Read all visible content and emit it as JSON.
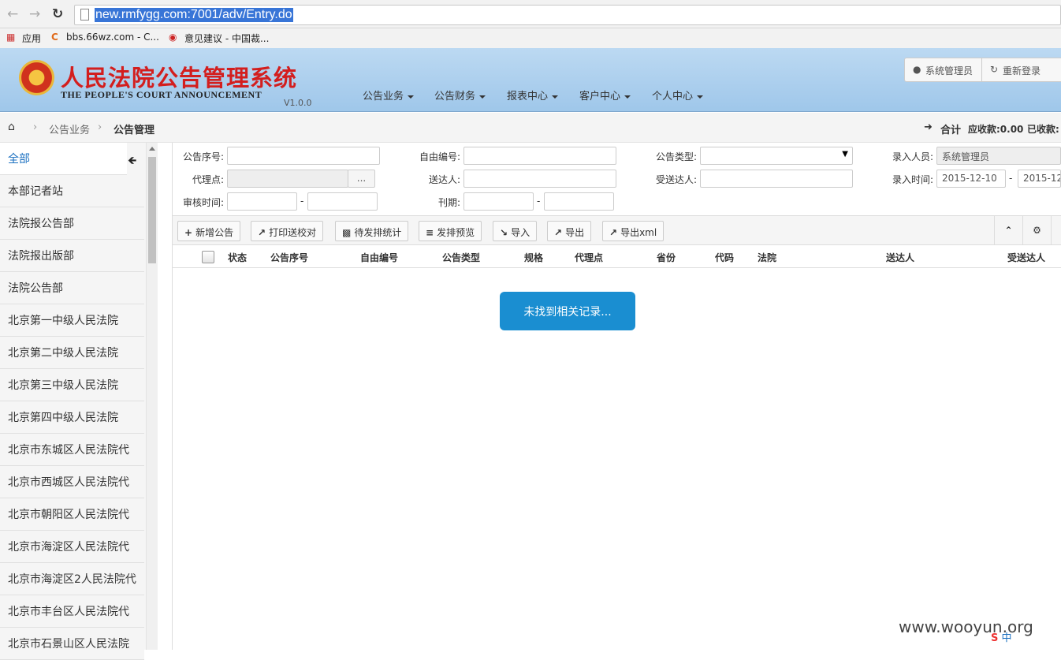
{
  "browser": {
    "back_icon": "arrow-left-icon",
    "forward_icon": "arrow-right-icon",
    "reload_icon": "reload-icon",
    "url": "new.rmfygg.com:7001/adv/Entry.do",
    "bookmarks": [
      "应用",
      "bbs.66wz.com - C...",
      "意见建议 - 中国裁..."
    ]
  },
  "header": {
    "title_cn": "人民法院公告管理系统",
    "title_en": "THE PEOPLE'S COURT ANNOUNCEMENT",
    "version": "V1.0.0",
    "menu": [
      "公告业务",
      "公告财务",
      "报表中心",
      "客户中心",
      "个人中心"
    ],
    "user_label": "系统管理员",
    "relogin_label": "重新登录"
  },
  "breadcrumb": {
    "items": [
      "公告业务",
      "公告管理"
    ],
    "summary_total": "合计",
    "summary_receivable": "应收款:0.00",
    "summary_received": "已收款:"
  },
  "sidebar": {
    "items": [
      "全部",
      "本部记者站",
      "法院报公告部",
      "法院报出版部",
      "法院公告部",
      "北京第一中级人民法院",
      "北京第二中级人民法院",
      "北京第三中级人民法院",
      "北京第四中级人民法院",
      "北京市东城区人民法院代",
      "北京市西城区人民法院代",
      "北京市朝阳区人民法院代",
      "北京市海淀区人民法院代",
      "北京市海淀区2人民法院代",
      "北京市丰台区人民法院代",
      "北京市石景山区人民法院"
    ]
  },
  "filters": {
    "serial_label": "公告序号:",
    "free_no_label": "自由编号:",
    "type_label": "公告类型:",
    "entry_user_label": "录入人员:",
    "entry_user_value": "系统管理员",
    "agent_label": "代理点:",
    "agent_btn": "...",
    "sender_label": "送达人:",
    "receiver_label": "受送达人:",
    "entry_time_label": "录入时间:",
    "entry_time_from": "2015-12-10",
    "entry_time_to": "2015-12-",
    "audit_time_label": "审核时间:",
    "issue_label": "刊期:",
    "range_sep": "-"
  },
  "toolbar": {
    "buttons": [
      "新增公告",
      "打印送校对",
      "待发排统计",
      "发排预览",
      "导入",
      "导出",
      "导出xml"
    ]
  },
  "table": {
    "columns": [
      "状态",
      "公告序号",
      "自由编号",
      "公告类型",
      "规格",
      "代理点",
      "省份",
      "代码",
      "法院",
      "送达人",
      "受送达人"
    ],
    "empty_text": "未找到相关记录..."
  },
  "watermark": "www.wooyun.org",
  "ime": "中"
}
